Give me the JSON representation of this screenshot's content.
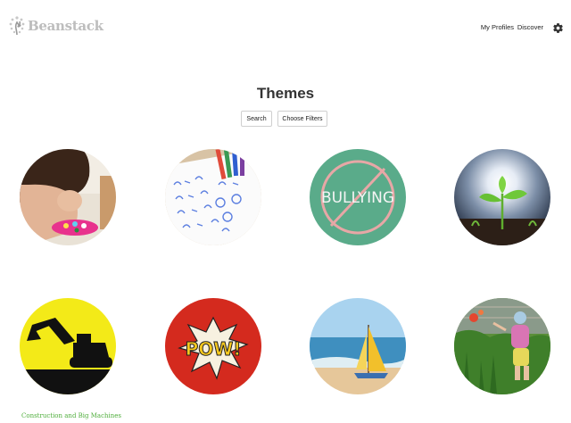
{
  "app": {
    "name": "Beanstack"
  },
  "nav": {
    "my_profiles": "My Profiles",
    "discover": "Discover",
    "settings_icon": "gear-icon"
  },
  "page": {
    "title": "Themes"
  },
  "controls": {
    "search_label": "Search",
    "filters_label": "Choose Filters"
  },
  "themes": [
    {
      "image": "child-playing-with-pink-toy"
    },
    {
      "image": "math-worksheet-with-crayons"
    },
    {
      "image": "bullying-crossed-out-on-chalkboard",
      "image_text": "BULLYING"
    },
    {
      "image": "seedling-sprout-in-sunlight"
    },
    {
      "image": "excavator-silhouette-on-yellow",
      "caption": "Construction and Big Machines"
    },
    {
      "image": "pow-comic-burst",
      "image_text": "POW!"
    },
    {
      "image": "sailboat-on-beach"
    },
    {
      "image": "toddler-in-flower-garden"
    }
  ],
  "colors": {
    "caption_green": "#4fae3c",
    "logo_gray": "#bdbdbd",
    "chalkboard_green": "#5aab8a",
    "pow_red": "#d42a1e"
  }
}
